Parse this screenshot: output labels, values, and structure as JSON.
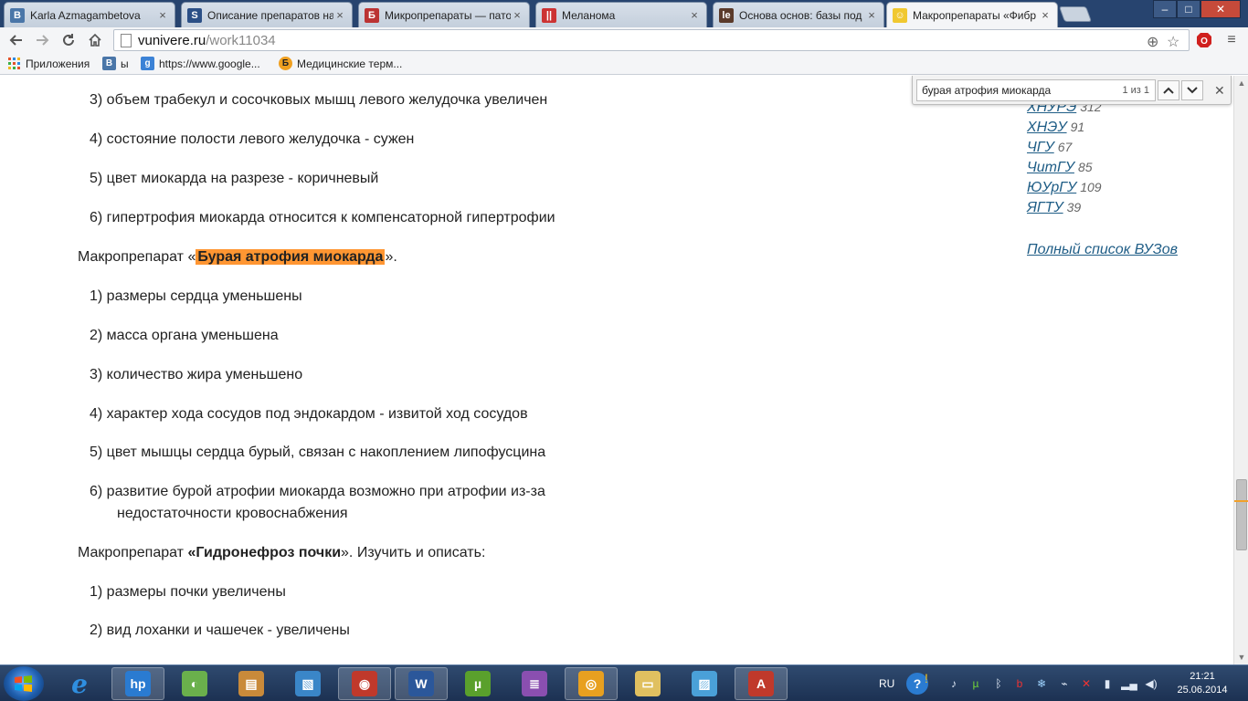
{
  "browser": {
    "tabs": [
      {
        "title": "Karla Azmagambetova",
        "favicon": "vk-icon",
        "color": "#4a76a8",
        "glyph": "B"
      },
      {
        "title": "Описание препаратов на",
        "favicon": "studfiles-icon",
        "color": "#2b4f86",
        "glyph": "S"
      },
      {
        "title": "Микропрепараты — пато",
        "favicon": "slide-icon",
        "color": "#b33",
        "glyph": "Б"
      },
      {
        "title": "Меланома",
        "favicon": "bookmark-icon",
        "color": "#c33",
        "glyph": "||"
      },
      {
        "title": "Основа основ: базы под",
        "favicon": "site-icon",
        "color": "#5a3a2a",
        "glyph": "le"
      },
      {
        "title": "Макропрепараты «Фибр",
        "favicon": "smiley-icon",
        "color": "#f0c830",
        "glyph": "☺"
      }
    ],
    "active_tab": 5,
    "url_host": "vunivere.ru",
    "url_path": "/work11034",
    "window_controls": {
      "minimize": "–",
      "maximize": "□",
      "close": "✕"
    }
  },
  "bookmarks": [
    {
      "label": "Приложения",
      "icon": "apps-grid-icon"
    },
    {
      "label": "ы",
      "icon": "vk-icon"
    },
    {
      "label": "https://www.google...",
      "icon": "google-icon"
    },
    {
      "label": "Медицинские терм...",
      "icon": "med-icon"
    }
  ],
  "find": {
    "query": "бурая атрофия миокарда",
    "count": "1 из 1",
    "prev": "︿",
    "next": "﹀",
    "close": "✕"
  },
  "content": {
    "lines": [
      {
        "kind": "item",
        "text": "3)  объем трабекул и сосочковых мышц левого желудочка увеличен"
      },
      {
        "kind": "item",
        "text": "4)  состояние полости левого желудочка - сужен"
      },
      {
        "kind": "item",
        "text": "5)  цвет миокарда на разрезе - коричневый"
      },
      {
        "kind": "item",
        "text": "6)  гипертрофия миокарда относится к компенсаторной гипертрофии"
      },
      {
        "kind": "heading",
        "before": "Макропрепарат «",
        "bold": "Бурая атрофия миокарда",
        "after": "».",
        "highlighted": true
      },
      {
        "kind": "item",
        "text": "1)  размеры сердца уменьшены"
      },
      {
        "kind": "item",
        "text": "2)  масса органа уменьшена"
      },
      {
        "kind": "item",
        "text": "3)  количество жира уменьшено"
      },
      {
        "kind": "item",
        "text": "4)  характер хода сосудов под эндокардом - извитой ход сосудов"
      },
      {
        "kind": "item",
        "text": "5)  цвет мышцы сердца бурый, связан с накоплением липофусцина"
      },
      {
        "kind": "item",
        "text": "6)  развитие бурой атрофии миокарда возможно при атрофии из-за"
      },
      {
        "kind": "cont",
        "text": "недостаточности кровоснабжения"
      },
      {
        "kind": "heading",
        "before": "Макропрепарат ",
        "bold": "«Гидронефроз почки",
        "after": "». Изучить и описать:",
        "highlighted": false
      },
      {
        "kind": "item",
        "text": "1)  размеры почки увеличены"
      },
      {
        "kind": "item",
        "text": "2)  вид лоханки и чашечек - увеличены"
      }
    ],
    "sidebar_universities": [
      {
        "name": "ХНУРЭ",
        "count": "312"
      },
      {
        "name": "ХНЭУ",
        "count": "91"
      },
      {
        "name": "ЧГУ",
        "count": "67"
      },
      {
        "name": "ЧитГУ",
        "count": "85"
      },
      {
        "name": "ЮУрГУ",
        "count": "109"
      },
      {
        "name": "ЯГТУ",
        "count": "39"
      }
    ],
    "full_list_link": "Полный список ВУЗов",
    "highlight_color": "#ff9632"
  },
  "taskbar": {
    "apps": [
      {
        "name": "hp-app",
        "color": "#2a7bd1",
        "glyph": "hp",
        "open": true
      },
      {
        "name": "maps-app",
        "color": "#6ab04c",
        "glyph": "◐",
        "open": false
      },
      {
        "name": "explorer-app",
        "color": "#c98a3a",
        "glyph": "▤",
        "open": false
      },
      {
        "name": "photo-app",
        "color": "#3a86c8",
        "glyph": "▧",
        "open": false
      },
      {
        "name": "media-app",
        "color": "#c0392b",
        "glyph": "◉",
        "open": true
      },
      {
        "name": "word-app",
        "color": "#2b579a",
        "glyph": "W",
        "open": true
      },
      {
        "name": "utorrent-app",
        "color": "#5aa02c",
        "glyph": "µ",
        "open": false
      },
      {
        "name": "winrar-app",
        "color": "#8a4fb0",
        "glyph": "≣",
        "open": false
      },
      {
        "name": "chrome-app",
        "color": "#e8a020",
        "glyph": "◎",
        "open": true
      },
      {
        "name": "folder-app",
        "color": "#e0c060",
        "glyph": "▭",
        "open": false
      },
      {
        "name": "paint-app",
        "color": "#4aa0d8",
        "glyph": "▨",
        "open": false
      },
      {
        "name": "acrobat-app",
        "color": "#c0392b",
        "glyph": "A",
        "open": true
      }
    ],
    "language": "RU",
    "time": "21:21",
    "date": "25.06.2014"
  }
}
